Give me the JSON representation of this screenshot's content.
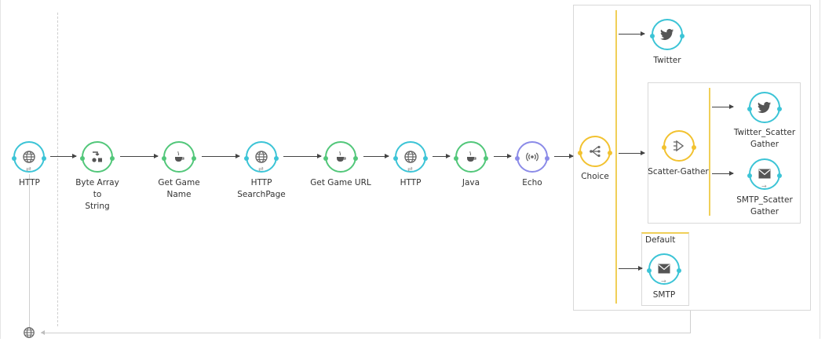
{
  "flow": {
    "source": {
      "label": "HTTP",
      "icon": "globe-icon"
    },
    "steps": [
      {
        "label": "Byte Array to\nString",
        "icon": "transformer-icon"
      },
      {
        "label": "Get Game\nName",
        "icon": "coffee-icon"
      },
      {
        "label": "HTTP\nSearchPage",
        "icon": "globe-icon"
      },
      {
        "label": "Get Game URL",
        "icon": "coffee-icon"
      },
      {
        "label": "HTTP",
        "icon": "globe-icon"
      },
      {
        "label": "Java",
        "icon": "coffee-icon"
      },
      {
        "label": "Echo",
        "icon": "echo-icon"
      }
    ],
    "router": {
      "label": "Choice",
      "icon": "choice-icon"
    },
    "routes": {
      "twitter": {
        "label": "Twitter",
        "icon": "twitter-icon"
      },
      "scatter_gather": {
        "label": "Scatter-Gather",
        "icon": "scatter-gather-icon"
      },
      "twitter_scatter": {
        "label": "Twitter_Scatter\nGather",
        "icon": "twitter-icon"
      },
      "smtp_scatter": {
        "label": "SMTP_Scatter\nGather",
        "icon": "mail-icon"
      },
      "default_label": "Default",
      "smtp": {
        "label": "SMTP",
        "icon": "mail-icon"
      }
    },
    "return_endpoint": {
      "icon": "globe-icon"
    }
  },
  "colors": {
    "endpoint": "#3cc4d6",
    "processor": "#52c77a",
    "echo": "#8b8be8",
    "router": "#f2c230"
  }
}
